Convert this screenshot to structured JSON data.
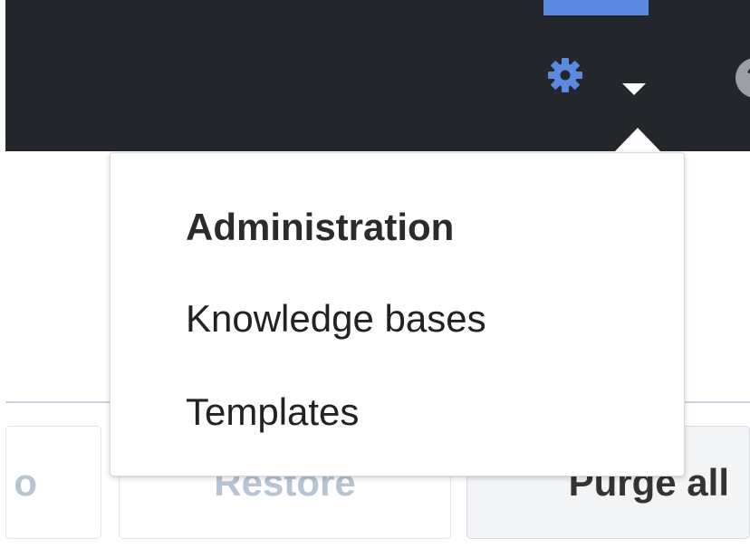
{
  "topbar": {
    "settings_icon": "gear-icon",
    "dropdown_icon": "caret-down-icon",
    "help_icon": "help-icon",
    "help_glyph": "?",
    "accent_color": "#5b8ae0",
    "background_color": "#23262b"
  },
  "menu": {
    "header": "Administration",
    "items": [
      {
        "label": "Knowledge bases"
      },
      {
        "label": "Templates"
      }
    ]
  },
  "toolbar": {
    "partial_label": "o",
    "restore_label": "Restore",
    "purge_label": "Purge all"
  }
}
